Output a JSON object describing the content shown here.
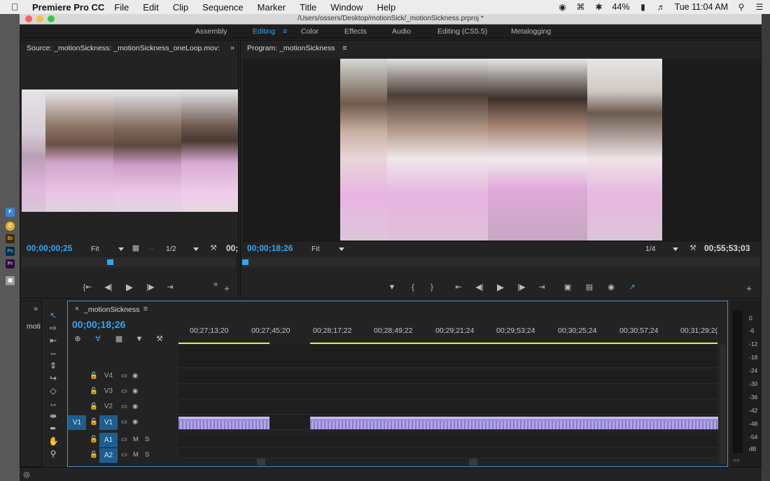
{
  "menubar": {
    "app_name": "Premiere Pro CC",
    "items": [
      "File",
      "Edit",
      "Clip",
      "Sequence",
      "Marker",
      "Title",
      "Window",
      "Help"
    ],
    "battery": "44%",
    "clock": "Tue 11:04 AM"
  },
  "window": {
    "title": "/Users/ossers/Desktop/motionSick/_motionSickness.prproj *"
  },
  "workspaces": {
    "items": [
      "Assembly",
      "Editing",
      "Color",
      "Effects",
      "Audio",
      "Editing (CS5.5)",
      "Metalogging"
    ],
    "active": "Editing"
  },
  "source": {
    "title": "Source: _motionSickness: _motionSickness_oneLoop.mov:",
    "timecode": "00;00;00;25",
    "zoom": "Fit",
    "resolution": "1/2",
    "timecode_right": "00;"
  },
  "program": {
    "title": "Program: _motionSickness",
    "timecode": "00;00;18;26",
    "zoom": "Fit",
    "resolution": "1/4",
    "duration": "00;55;53;03"
  },
  "timeline": {
    "sequence_name": "_motionSickness",
    "timecode": "00;00;18;26",
    "ruler_labels": [
      "00;27;13;20",
      "00;27;45;20",
      "00;28;17;22",
      "00;28;49;22",
      "00;29;21;24",
      "00;29;53;24",
      "00;30;25;24",
      "00;30;57;24",
      "00;31;29;2("
    ],
    "left_panel_label": "moti",
    "tracks": [
      {
        "name": "V4",
        "type": "video",
        "target": ""
      },
      {
        "name": "V3",
        "type": "video",
        "target": ""
      },
      {
        "name": "V2",
        "type": "video",
        "target": ""
      },
      {
        "name": "V1",
        "type": "video",
        "target": "V1"
      },
      {
        "name": "A1",
        "type": "audio",
        "target": ""
      },
      {
        "name": "A2",
        "type": "audio",
        "target": ""
      }
    ],
    "mute_label": "M",
    "solo_label": "S"
  },
  "meter": {
    "labels": [
      "0",
      "-6",
      "-12",
      "-18",
      "-24",
      "-30",
      "-36",
      "-42",
      "-48",
      "-54",
      "dB"
    ]
  },
  "colors": {
    "accent": "#34a6f5",
    "clip": "#9f8fd8",
    "work_area": "#ecec39",
    "panel": "#232323"
  }
}
